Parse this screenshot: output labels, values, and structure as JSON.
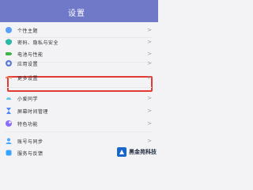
{
  "status_bar": {
    "time": "",
    "right": ""
  },
  "header": {
    "title": "设置"
  },
  "items": [
    {
      "name": "personalization",
      "label": "个性主题",
      "icon": "palette-icon",
      "color": "#5aa0ff"
    },
    {
      "name": "privacy-security",
      "label": "密码、隐私与安全",
      "icon": "shield-icon",
      "color": "#2bb8a6"
    },
    {
      "name": "battery",
      "label": "电池与性能",
      "icon": "battery-icon",
      "color": "#42b54a"
    },
    {
      "name": "app-settings",
      "label": "应用设置",
      "icon": "app-icon",
      "color": "#5b7bd6"
    },
    {
      "name": "more-settings",
      "label": "更多设置",
      "icon": "more-icon",
      "color": "#f08a5d"
    },
    {
      "name": "mi-assistant",
      "label": "小爱同学",
      "icon": "assistant-icon",
      "color": "#6cc3e8"
    },
    {
      "name": "screen-time",
      "label": "屏幕时间管理",
      "icon": "hourglass-icon",
      "color": "#4f86f7"
    },
    {
      "name": "special-features",
      "label": "特色功能",
      "icon": "feature-icon",
      "color": "#8a6cff"
    },
    {
      "name": "account-sync",
      "label": "账号与同步",
      "icon": "account-icon",
      "color": "#4aa6ff"
    },
    {
      "name": "feedback",
      "label": "服务与反馈",
      "icon": "feedback-icon",
      "color": "#36a3ff"
    }
  ],
  "chevron": ">",
  "watermark": {
    "text": "黑金苑科技"
  },
  "colors": {
    "header": "#6f79c8",
    "highlight": "#e33a33",
    "background": "#f3f3f6"
  }
}
